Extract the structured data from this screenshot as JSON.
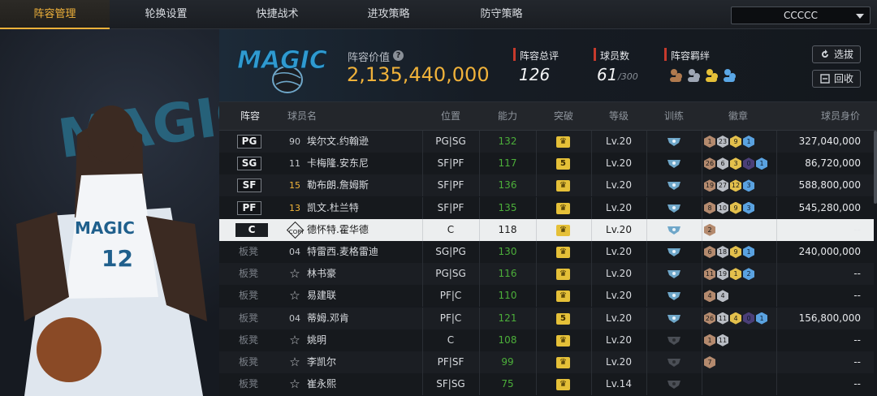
{
  "tabs": [
    "阵容管理",
    "轮换设置",
    "快捷战术",
    "进攻策略",
    "防守策略"
  ],
  "team_select": {
    "value": "CCCCC"
  },
  "header": {
    "logo_text": "MAGIC",
    "value_label": "阵容价值",
    "value": "2,135,440,000",
    "rating_label": "阵容总评",
    "rating": "126",
    "players_label": "球员数",
    "players": "61",
    "players_max": "/300",
    "bond_label": "阵容羁绊",
    "pick_button": "选拔",
    "recycle_button": "回收"
  },
  "columns": [
    "阵容",
    "球员名",
    "位置",
    "能力",
    "突破",
    "等级",
    "训练",
    "徽章",
    "球员身价"
  ],
  "rows": [
    {
      "slot": "PG",
      "bench": false,
      "num": "90",
      "gold": false,
      "name": "埃尔文.约翰逊",
      "pos": "PG|SG",
      "ability": "132",
      "brk": "♛",
      "level": "Lv.20",
      "train": "blue",
      "badges": [
        [
          "1",
          "b"
        ],
        [
          "23",
          "s"
        ],
        [
          "9",
          "g"
        ],
        [
          "1",
          "p"
        ]
      ],
      "value": "327,040,000"
    },
    {
      "slot": "SG",
      "bench": false,
      "num": "11",
      "gold": false,
      "name": "卡梅隆.安东尼",
      "pos": "SF|PF",
      "ability": "117",
      "brk": "5",
      "level": "Lv.20",
      "train": "blue",
      "badges": [
        [
          "26",
          "b"
        ],
        [
          "6",
          "s"
        ],
        [
          "3",
          "g"
        ],
        [
          "0",
          "d"
        ],
        [
          "1",
          "p"
        ]
      ],
      "value": "86,720,000"
    },
    {
      "slot": "SF",
      "bench": false,
      "num": "15",
      "gold": true,
      "name": "勒布朗.詹姆斯",
      "pos": "SF|PF",
      "ability": "136",
      "brk": "♛",
      "level": "Lv.20",
      "train": "blue",
      "badges": [
        [
          "19",
          "b"
        ],
        [
          "27",
          "s"
        ],
        [
          "12",
          "g"
        ],
        [
          "3",
          "p"
        ]
      ],
      "value": "588,800,000"
    },
    {
      "slot": "PF",
      "bench": false,
      "num": "13",
      "gold": true,
      "name": "凯文.杜兰特",
      "pos": "SF|PF",
      "ability": "135",
      "brk": "♛",
      "level": "Lv.20",
      "train": "blue",
      "badges": [
        [
          "8",
          "b"
        ],
        [
          "10",
          "s"
        ],
        [
          "9",
          "g"
        ],
        [
          "3",
          "p"
        ]
      ],
      "value": "545,280,000"
    },
    {
      "slot": "C",
      "bench": false,
      "num": "COPY",
      "gold": false,
      "name": "德怀特.霍华德",
      "pos": "C",
      "ability": "118",
      "brk": "♛",
      "level": "Lv.20",
      "train": "blue",
      "badges": [
        [
          "2",
          "b"
        ]
      ],
      "value": "--",
      "selected": true
    },
    {
      "slot": "板凳",
      "bench": true,
      "num": "04",
      "gold": false,
      "name": "特雷西.麦格雷迪",
      "pos": "SG|PG",
      "ability": "130",
      "brk": "♛",
      "level": "Lv.20",
      "train": "blue",
      "badges": [
        [
          "6",
          "b"
        ],
        [
          "18",
          "s"
        ],
        [
          "9",
          "g"
        ],
        [
          "1",
          "p"
        ]
      ],
      "value": "240,000,000"
    },
    {
      "slot": "板凳",
      "bench": true,
      "num": "☆",
      "gold": false,
      "name": "林书豪",
      "pos": "PG|SG",
      "ability": "116",
      "brk": "♛",
      "level": "Lv.20",
      "train": "blue",
      "badges": [
        [
          "11",
          "b"
        ],
        [
          "19",
          "s"
        ],
        [
          "1",
          "g"
        ],
        [
          "2",
          "p"
        ]
      ],
      "value": "--"
    },
    {
      "slot": "板凳",
      "bench": true,
      "num": "☆",
      "gold": false,
      "name": "易建联",
      "pos": "PF|C",
      "ability": "110",
      "brk": "♛",
      "level": "Lv.20",
      "train": "blue",
      "badges": [
        [
          "4",
          "b"
        ],
        [
          "4",
          "s"
        ]
      ],
      "value": "--"
    },
    {
      "slot": "板凳",
      "bench": true,
      "num": "04",
      "gold": false,
      "name": "蒂姆.邓肯",
      "pos": "PF|C",
      "ability": "121",
      "brk": "5",
      "level": "Lv.20",
      "train": "blue",
      "badges": [
        [
          "26",
          "b"
        ],
        [
          "11",
          "s"
        ],
        [
          "4",
          "g"
        ],
        [
          "0",
          "d"
        ],
        [
          "1",
          "p"
        ]
      ],
      "value": "156,800,000"
    },
    {
      "slot": "板凳",
      "bench": true,
      "num": "☆",
      "gold": false,
      "name": "姚明",
      "pos": "C",
      "ability": "108",
      "brk": "♛",
      "level": "Lv.20",
      "train": "gray",
      "badges": [
        [
          "1",
          "b"
        ],
        [
          "11",
          "s"
        ]
      ],
      "value": "--"
    },
    {
      "slot": "板凳",
      "bench": true,
      "num": "☆",
      "gold": false,
      "name": "李凯尔",
      "pos": "PF|SF",
      "ability": "99",
      "brk": "♛",
      "level": "Lv.20",
      "train": "gray",
      "badges": [
        [
          "7",
          "b"
        ]
      ],
      "value": "--"
    },
    {
      "slot": "板凳",
      "bench": true,
      "num": "☆",
      "gold": false,
      "name": "崔永熙",
      "pos": "SF|SG",
      "ability": "75",
      "brk": "♛",
      "level": "Lv.14",
      "train": "gray",
      "badges": [],
      "value": "--"
    }
  ]
}
